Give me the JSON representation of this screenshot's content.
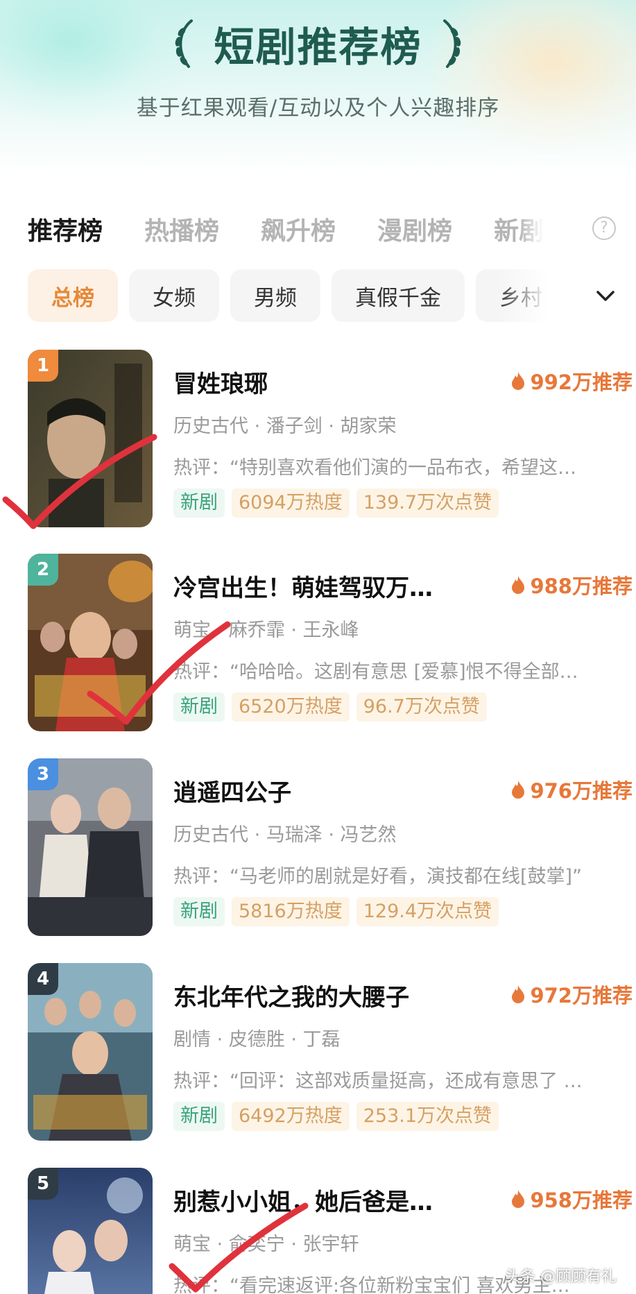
{
  "header": {
    "title": "短剧推荐榜",
    "subtitle": "基于红果观看/互动以及个人兴趣排序"
  },
  "tabs": [
    {
      "label": "推荐榜",
      "active": true
    },
    {
      "label": "热播榜",
      "active": false
    },
    {
      "label": "飙升榜",
      "active": false
    },
    {
      "label": "漫剧榜",
      "active": false
    },
    {
      "label": "新剧",
      "active": false
    }
  ],
  "filters": [
    {
      "label": "总榜",
      "active": true
    },
    {
      "label": "女频",
      "active": false
    },
    {
      "label": "男频",
      "active": false
    },
    {
      "label": "真假千金",
      "active": false
    },
    {
      "label": "乡村",
      "active": false
    }
  ],
  "items": [
    {
      "rank": "1",
      "title": "冒姓琅琊",
      "recommend": "992万推荐",
      "meta": "历史古代 · 潘子剑 · 胡家荣",
      "review": "热评：“特别喜欢看他们演的一品布衣，希望这…",
      "tags": [
        "新剧",
        "6094万热度",
        "139.7万次点赞"
      ]
    },
    {
      "rank": "2",
      "title": "冷宫出生！萌娃驾驭万…",
      "recommend": "988万推荐",
      "meta": "萌宝 · 麻乔霏 · 王永峰",
      "review": "热评：“哈哈哈。这剧有意思 [爱慕]恨不得全部…",
      "tags": [
        "新剧",
        "6520万热度",
        "96.7万次点赞"
      ]
    },
    {
      "rank": "3",
      "title": "逍遥四公子",
      "recommend": "976万推荐",
      "meta": "历史古代 · 马瑞泽 · 冯艺然",
      "review": "热评：“马老师的剧就是好看，演技都在线[鼓掌]”",
      "tags": [
        "新剧",
        "5816万热度",
        "129.4万次点赞"
      ]
    },
    {
      "rank": "4",
      "title": "东北年代之我的大腰子",
      "recommend": "972万推荐",
      "meta": "剧情 · 皮德胜 · 丁磊",
      "review": "热评：“回评：这部戏质量挺高，还成有意思了 …",
      "tags": [
        "新剧",
        "6492万热度",
        "253.1万次点赞"
      ]
    },
    {
      "rank": "5",
      "title": "别惹小小姐，她后爸是…",
      "recommend": "958万推荐",
      "meta": "萌宝 · 俞奕宁 · 张宇轩",
      "review": "热评：“看完速返评:各位新粉宝宝们 喜欢男主…",
      "tags": []
    }
  ],
  "watermark": "头条 @顾顾有礼",
  "colors": {
    "accent": "#e7783a",
    "title": "#1f5c4f",
    "check": "#e0323c"
  }
}
